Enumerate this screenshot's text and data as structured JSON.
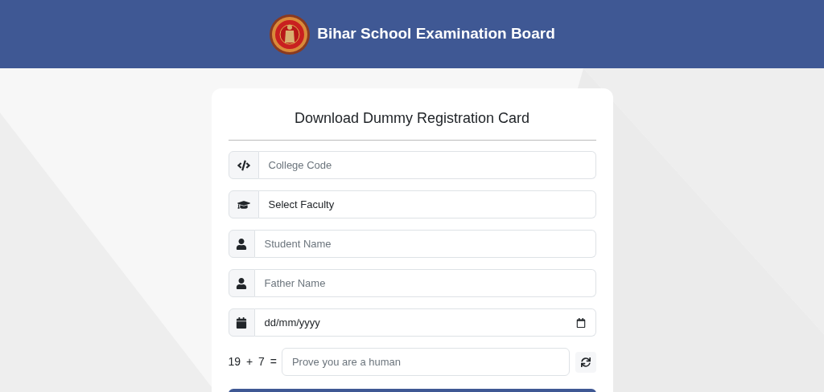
{
  "header": {
    "title": "Bihar School Examination Board"
  },
  "form": {
    "title": "Download Dummy Registration Card",
    "fields": [
      {
        "kind": "code",
        "placeholder": "College Code"
      },
      {
        "kind": "select",
        "value": "Select Faculty"
      },
      {
        "kind": "person",
        "placeholder": "Student Name"
      },
      {
        "kind": "person",
        "placeholder": "Father Name"
      },
      {
        "kind": "date",
        "value": "dd/mm/yyyy"
      }
    ],
    "captcha": {
      "question": "19 + 7 =",
      "placeholder": "Prove you are a human"
    }
  }
}
